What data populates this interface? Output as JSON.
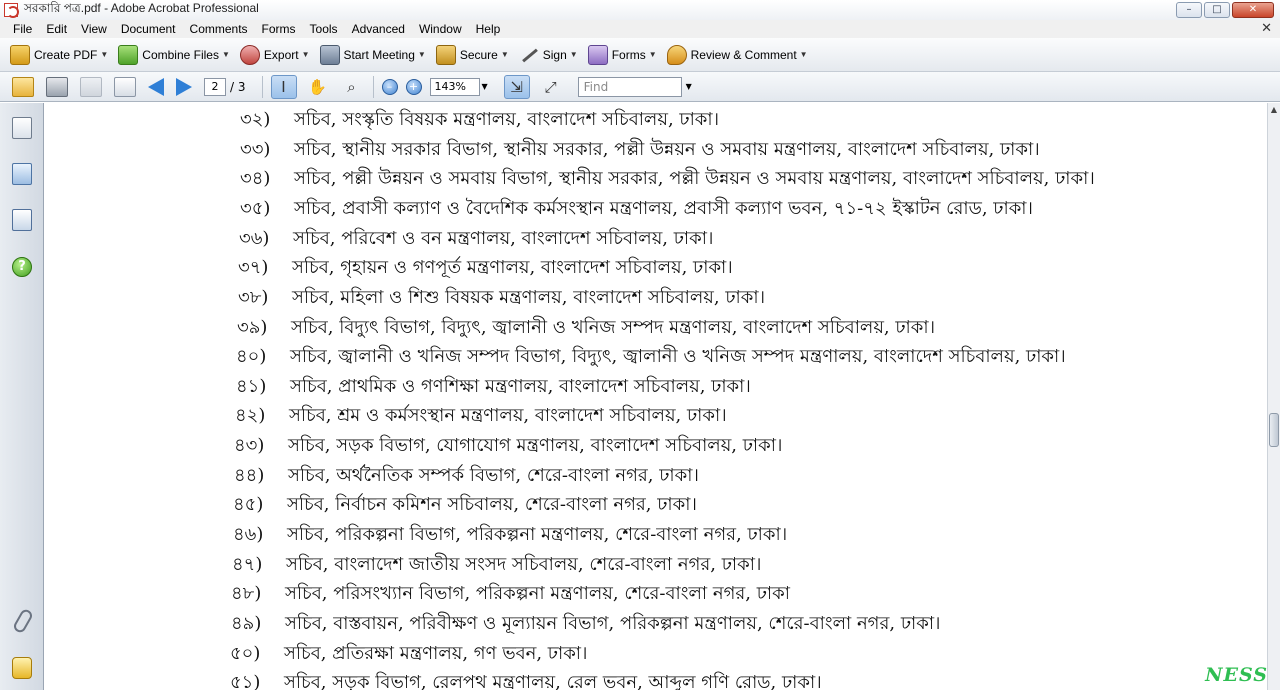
{
  "window": {
    "title": "সরকারি পত্র.pdf - Adobe Acrobat Professional",
    "controls": {
      "minimize": "–",
      "maximize": "□",
      "close": "✕"
    }
  },
  "menubar": {
    "items": [
      "File",
      "Edit",
      "View",
      "Document",
      "Comments",
      "Forms",
      "Tools",
      "Advanced",
      "Window",
      "Help"
    ],
    "close_glyph": "✕"
  },
  "tasks": {
    "create_pdf": "Create PDF",
    "combine_files": "Combine Files",
    "export": "Export",
    "start_meeting": "Start Meeting",
    "secure": "Secure",
    "sign": "Sign",
    "forms": "Forms",
    "review_comment": "Review & Comment",
    "caret": "▼"
  },
  "toolbar": {
    "page_current": "2",
    "page_total": "/ 3",
    "zoom": "143%",
    "find_placeholder": "Find",
    "caret": "▼",
    "zoom_out": "–",
    "zoom_in": "+",
    "select_tool": "I",
    "hand_tool": "✋",
    "marquee_tool": "⌕",
    "fit_page": "⇲",
    "full_screen": "⤢"
  },
  "nav": {
    "help": "?"
  },
  "document": {
    "lines": [
      {
        "num": "৩২)",
        "text": "সচিব, সংস্কৃতি বিষয়ক মন্ত্রণালয়, বাংলাদেশ সচিবালয়, ঢাকা।"
      },
      {
        "num": "৩৩)",
        "text": "সচিব, স্থানীয় সরকার বিভাগ, স্থানীয় সরকার, পল্লী উন্নয়ন ও সমবায় মন্ত্রণালয়, বাংলাদেশ সচিবালয়, ঢাকা।"
      },
      {
        "num": "৩৪)",
        "text": "সচিব, পল্লী উন্নয়ন ও সমবায় বিভাগ, স্থানীয় সরকার, পল্লী উন্নয়ন ও সমবায় মন্ত্রণালয়, বাংলাদেশ সচিবালয়, ঢাকা।"
      },
      {
        "num": "৩৫)",
        "text": "সচিব, প্রবাসী কল্যাণ ও বৈদেশিক কর্মসংস্থান মন্ত্রণালয়, প্রবাসী কল্যাণ ভবন, ৭১-৭২ ইস্কাটন রোড, ঢাকা।"
      },
      {
        "num": "৩৬)",
        "text": "সচিব, পরিবেশ ও বন মন্ত্রণালয়, বাংলাদেশ সচিবালয়, ঢাকা।"
      },
      {
        "num": "৩৭)",
        "text": "সচিব, গৃহায়ন ও গণপূর্ত মন্ত্রণালয়, বাংলাদেশ সচিবালয়, ঢাকা।"
      },
      {
        "num": "৩৮)",
        "text": "সচিব, মহিলা ও শিশু বিষয়ক মন্ত্রণালয়, বাংলাদেশ সচিবালয়, ঢাকা।"
      },
      {
        "num": "৩৯)",
        "text": "সচিব, বিদ্যুৎ বিভাগ, বিদ্যুৎ, জ্বালানী ও খনিজ সম্পদ মন্ত্রণালয়, বাংলাদেশ সচিবালয়, ঢাকা।"
      },
      {
        "num": "৪০)",
        "text": "সচিব, জ্বালানী ও খনিজ সম্পদ বিভাগ, বিদ্যুৎ, জ্বালানী ও খনিজ সম্পদ মন্ত্রণালয়, বাংলাদেশ সচিবালয়, ঢাকা।"
      },
      {
        "num": "৪১)",
        "text": "সচিব, প্রাথমিক ও গণশিক্ষা মন্ত্রণালয়, বাংলাদেশ সচিবালয়, ঢাকা।"
      },
      {
        "num": "৪২)",
        "text": "সচিব, শ্রম ও কর্মসংস্থান মন্ত্রণালয়, বাংলাদেশ সচিবালয়, ঢাকা।"
      },
      {
        "num": "৪৩)",
        "text": "সচিব, সড়ক বিভাগ, যোগাযোগ মন্ত্রণালয়, বাংলাদেশ সচিবালয়, ঢাকা।"
      },
      {
        "num": "৪৪)",
        "text": "সচিব, অর্থনৈতিক সম্পর্ক বিভাগ, শেরে-বাংলা নগর, ঢাকা।"
      },
      {
        "num": "৪৫)",
        "text": "সচিব, নির্বাচন কমিশন সচিবালয়, শেরে-বাংলা নগর, ঢাকা।"
      },
      {
        "num": "৪৬)",
        "text": "সচিব, পরিকল্পনা বিভাগ, পরিকল্পনা মন্ত্রণালয়, শেরে-বাংলা নগর, ঢাকা।"
      },
      {
        "num": "৪৭)",
        "text": "সচিব, বাংলাদেশ জাতীয় সংসদ সচিবালয়, শেরে-বাংলা নগর, ঢাকা।"
      },
      {
        "num": "৪৮)",
        "text": "সচিব, পরিসংখ্যান বিভাগ, পরিকল্পনা মন্ত্রণালয়, শেরে-বাংলা নগর, ঢাকা"
      },
      {
        "num": "৪৯)",
        "text": "সচিব, বাস্তবায়ন, পরিবীক্ষণ ও মূল্যায়ন বিভাগ, পরিকল্পনা মন্ত্রণালয়, শেরে-বাংলা নগর, ঢাকা।"
      },
      {
        "num": "৫০)",
        "text": "সচিব, প্রতিরক্ষা মন্ত্রণালয়, গণ ভবন, ঢাকা।"
      },
      {
        "num": "৫১)",
        "text": "সচিব, সড়ক বিভাগ, রেলপথ মন্ত্রণালয়, রেল ভবন, আব্দুল গণি রোড, ঢাকা।"
      }
    ]
  },
  "scrollbar": {
    "up": "▲",
    "position_fraction": 0.55
  },
  "watermark": "NESS"
}
